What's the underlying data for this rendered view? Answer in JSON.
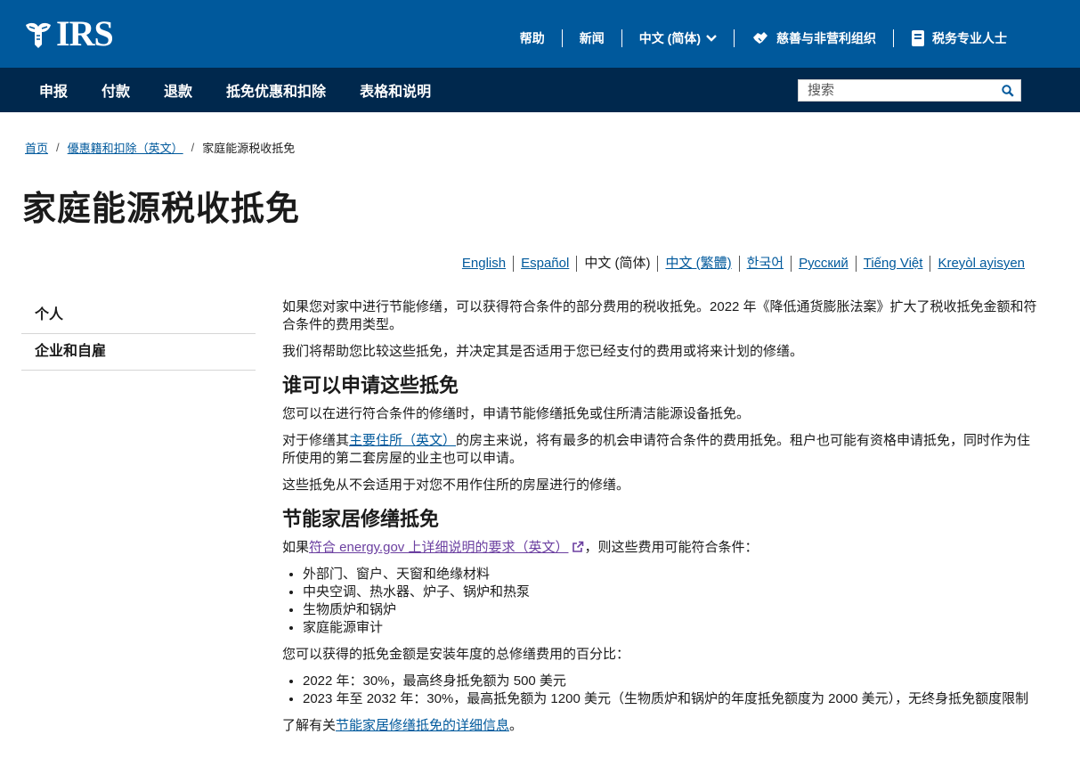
{
  "header": {
    "logo_text": "IRS",
    "links": [
      {
        "label": "帮助"
      },
      {
        "label": "新闻"
      },
      {
        "label": "中文 (简体)"
      },
      {
        "label": "慈善与非营利组织"
      },
      {
        "label": "税务专业人士"
      }
    ]
  },
  "nav": {
    "items": [
      "申报",
      "付款",
      "退款",
      "抵免优惠和扣除",
      "表格和说明"
    ],
    "search_placeholder": "搜索"
  },
  "breadcrumb": {
    "home": "首页",
    "parent": "優惠籍和扣除（英文）",
    "current": "家庭能源税收抵免"
  },
  "page_title": "家庭能源税收抵免",
  "languages": [
    {
      "label": "English",
      "active": false
    },
    {
      "label": "Español",
      "active": false
    },
    {
      "label": "中文 (简体)",
      "active": true
    },
    {
      "label": "中文 (繁體)",
      "active": false
    },
    {
      "label": "한국어",
      "active": false
    },
    {
      "label": "Русский",
      "active": false
    },
    {
      "label": "Tiếng Việt",
      "active": false
    },
    {
      "label": "Kreyòl ayisyen",
      "active": false
    }
  ],
  "sidebar": {
    "items": [
      "个人",
      "企业和自雇"
    ]
  },
  "content": {
    "intro_p1": "如果您对家中进行节能修缮，可以获得符合条件的部分费用的税收抵免。2022 年《降低通货膨胀法案》扩大了税收抵免金额和符合条件的费用类型。",
    "intro_p2": "我们将帮助您比较这些抵免，并决定其是否适用于您已经支付的费用或将来计划的修缮。",
    "h_who": "谁可以申请这些抵免",
    "who_p1": "您可以在进行符合条件的修缮时，申请节能修缮抵免或住所清洁能源设备抵免。",
    "who_p2_pre": "对于修缮其",
    "who_p2_link": "主要住所（英文）",
    "who_p2_post": "的房主来说，将有最多的机会申请符合条件的费用抵免。租户也可能有资格申请抵免，同时作为住所使用的第二套房屋的业主也可以申请。",
    "who_p3": "这些抵免从不会适用于对您不用作住所的房屋进行的修缮。",
    "h_energy": "节能家居修缮抵免",
    "en_p1_pre": "如果",
    "en_p1_link": "符合 energy.gov 上详细说明的要求（英文）",
    "en_p1_post": "，则这些费用可能符合条件：",
    "en_list": [
      "外部门、窗户、天窗和绝缘材料",
      "中央空调、热水器、炉子、锅炉和热泵",
      "生物质炉和锅炉",
      "家庭能源审计"
    ],
    "en_p2": "您可以获得的抵免金额是安装年度的总修缮费用的百分比：",
    "en_list2": [
      "2022 年：30%，最高终身抵免额为 500 美元",
      "2023 年至 2032 年：30%，最高抵免额为 1200 美元（生物质炉和锅炉的年度抵免额度为 2000 美元），无终身抵免额度限制"
    ],
    "en_p3_pre": "了解有关",
    "en_p3_link": "节能家居修缮抵免的详细信息",
    "en_p3_post": "。"
  }
}
